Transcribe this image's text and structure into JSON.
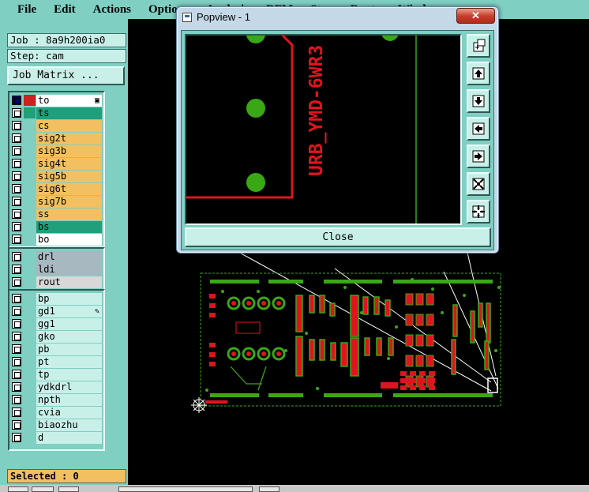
{
  "menu": [
    "File",
    "Edit",
    "Actions",
    "Options",
    "Analysis",
    "DFM",
    "Step",
    "Route",
    "Window"
  ],
  "job": {
    "label": "Job : 8a9h200ia0",
    "step": "Step: cam",
    "matrix_button": "Job Matrix ..."
  },
  "layers": {
    "board": [
      {
        "name": "to",
        "color": "#ffffff",
        "swatch": "#cc2222",
        "lead": "#000080"
      },
      {
        "name": "ts",
        "color": "#1fa07a",
        "swatch": "#1fa07a"
      },
      {
        "name": "cs",
        "color": "#f2c060"
      },
      {
        "name": "sig2t",
        "color": "#f2c060"
      },
      {
        "name": "sig3b",
        "color": "#f2c060"
      },
      {
        "name": "sig4t",
        "color": "#f2c060"
      },
      {
        "name": "sig5b",
        "color": "#f2c060"
      },
      {
        "name": "sig6t",
        "color": "#f2c060"
      },
      {
        "name": "sig7b",
        "color": "#f2c060"
      },
      {
        "name": "ss",
        "color": "#f2c060"
      },
      {
        "name": "bs",
        "color": "#1fa07a"
      },
      {
        "name": "bo",
        "color": "#ffffff"
      }
    ],
    "drill": [
      {
        "name": "drl",
        "color": "#a8b8c0"
      },
      {
        "name": "ldi",
        "color": "#a8b8c0"
      },
      {
        "name": "rout",
        "color": "#d8d8d8"
      }
    ],
    "misc": [
      {
        "name": "bp",
        "color": "#c8f0e8"
      },
      {
        "name": "gd1",
        "color": "#c8f0e8"
      },
      {
        "name": "gg1",
        "color": "#c8f0e8"
      },
      {
        "name": "gko",
        "color": "#c8f0e8"
      },
      {
        "name": "pb",
        "color": "#c8f0e8"
      },
      {
        "name": "pt",
        "color": "#c8f0e8"
      },
      {
        "name": "tp",
        "color": "#c8f0e8"
      },
      {
        "name": "ydkdrl",
        "color": "#c8f0e8"
      },
      {
        "name": "npth",
        "color": "#c8f0e8"
      },
      {
        "name": "cvia",
        "color": "#c8f0e8"
      },
      {
        "name": "biaozhu",
        "color": "#c8f0e8"
      },
      {
        "name": "d",
        "color": "#c8f0e8"
      }
    ]
  },
  "selected": "Selected : 0",
  "popview": {
    "title": "Popview - 1",
    "close_x": "✕",
    "close_label": "Close",
    "silk_text": "URB_YMD-6WR3",
    "tools": [
      "zoom-icon",
      "pan-up-icon",
      "pan-down-icon",
      "pan-left-icon",
      "pan-right-icon",
      "zoom-in-icon",
      "zoom-out-icon"
    ]
  },
  "colors": {
    "panel": "#7fcfc3",
    "field": "#c8f0e8",
    "pad_green": "#3aa815",
    "copper_red": "#e0141e"
  }
}
